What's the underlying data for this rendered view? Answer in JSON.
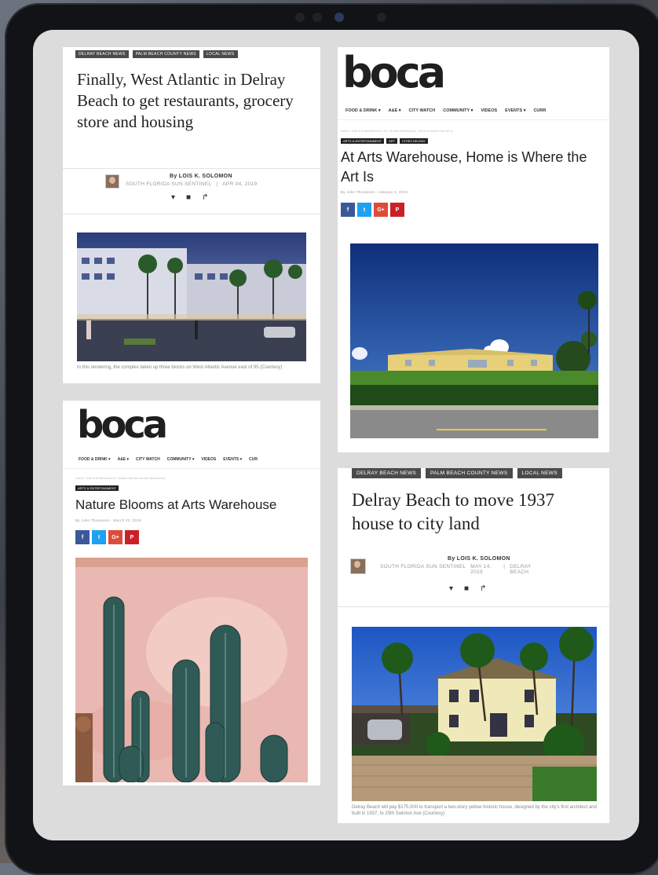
{
  "card1": {
    "tags": [
      "DELRAY BEACH NEWS",
      "PALM BEACH COUNTY NEWS",
      "LOCAL NEWS"
    ],
    "headline": "Finally, West Atlantic in Delray Beach to get restaurants, grocery store and housing",
    "byline": "By LOIS K. SOLOMON",
    "source": "SOUTH FLORIDA SUN SENTINEL",
    "date": "APR 04, 2019",
    "caption": "In this rendering, the complex taken up three blocks on West Atlantic Avenue east of 95 (Courtesy)"
  },
  "card2": {
    "logo": "boca",
    "nav": [
      "FOOD & DRINK ▾",
      "A&E ▾",
      "CITY WATCH",
      "COMMUNITY ▾",
      "VIDEOS",
      "EVENTS ▾",
      "CURR"
    ],
    "breadcrumb": "Home › Arts & Entertainment › Art › At Arts Warehouse, Home is Where the Art Is",
    "category_tags": [
      "ARTS & ENTERTAINMENT",
      "ART",
      "CITIES DELRAY"
    ],
    "headline": "At Arts Warehouse, Home is Where the Art Is",
    "byline": "By John Thomason - January 3, 2019",
    "social": [
      "f",
      "t",
      "G+",
      "P"
    ]
  },
  "card3": {
    "logo": "boca",
    "nav": [
      "FOOD & DRINK ▾",
      "A&E ▾",
      "CITY WATCH",
      "COMMUNITY ▾",
      "VIDEOS",
      "EVENTS ▾",
      "CUR"
    ],
    "breadcrumb": "Home › Arts & Entertainment › Nature Blooms at Arts Warehouse",
    "category_tags": [
      "ARTS & ENTERTAINMENT"
    ],
    "headline": "Nature Blooms at Arts Warehouse",
    "byline": "By John Thomason - March 22, 2019",
    "social": [
      "f",
      "t",
      "G+",
      "P"
    ]
  },
  "card4": {
    "tags": [
      "DELRAY BEACH NEWS",
      "PALM BEACH COUNTY NEWS",
      "LOCAL NEWS"
    ],
    "headline": "Delray Beach to move 1937 house to city land",
    "byline": "By LOIS K. SOLOMON",
    "source": "SOUTH FLORIDA SUN SENTINEL",
    "date": "MAY 14, 2019",
    "location": "DELRAY BEACH",
    "caption": "Delray Beach will pay $175,000 to transport a two-story yellow historic house, designed by the city's first architect and built in 1937, to 20th Swinton Ave (Courtesy)"
  },
  "icons": {
    "twitter": "▾",
    "facebook": "■",
    "share": "↱"
  }
}
